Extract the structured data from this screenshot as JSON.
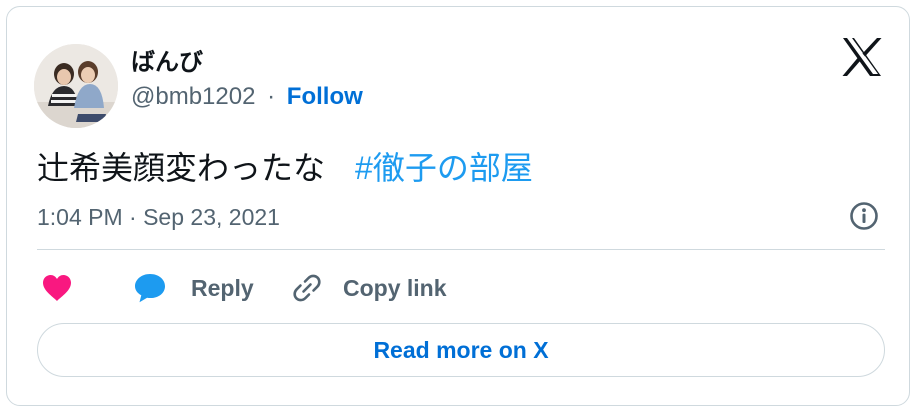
{
  "author": {
    "display_name": "ばんび",
    "handle": "@bmb1202",
    "separator": "·",
    "follow_label": "Follow"
  },
  "tweet": {
    "text": "辻希美顔変わったな",
    "hashtag": "#徹子の部屋",
    "timestamp": "1:04 PM · Sep 23, 2021"
  },
  "actions": {
    "reply_label": "Reply",
    "copy_link_label": "Copy link"
  },
  "read_more_label": "Read more on X",
  "icons": {
    "brand": "x-logo-icon",
    "info": "info-icon",
    "like": "heart-icon",
    "reply": "speech-bubble-icon",
    "copy": "link-icon"
  },
  "colors": {
    "link": "#006fd6",
    "hashtag": "#1d9bf0",
    "heart": "#f91880",
    "reply_bubble": "#1d9bf0",
    "secondary_text": "#536471",
    "border": "#cfd9de"
  }
}
